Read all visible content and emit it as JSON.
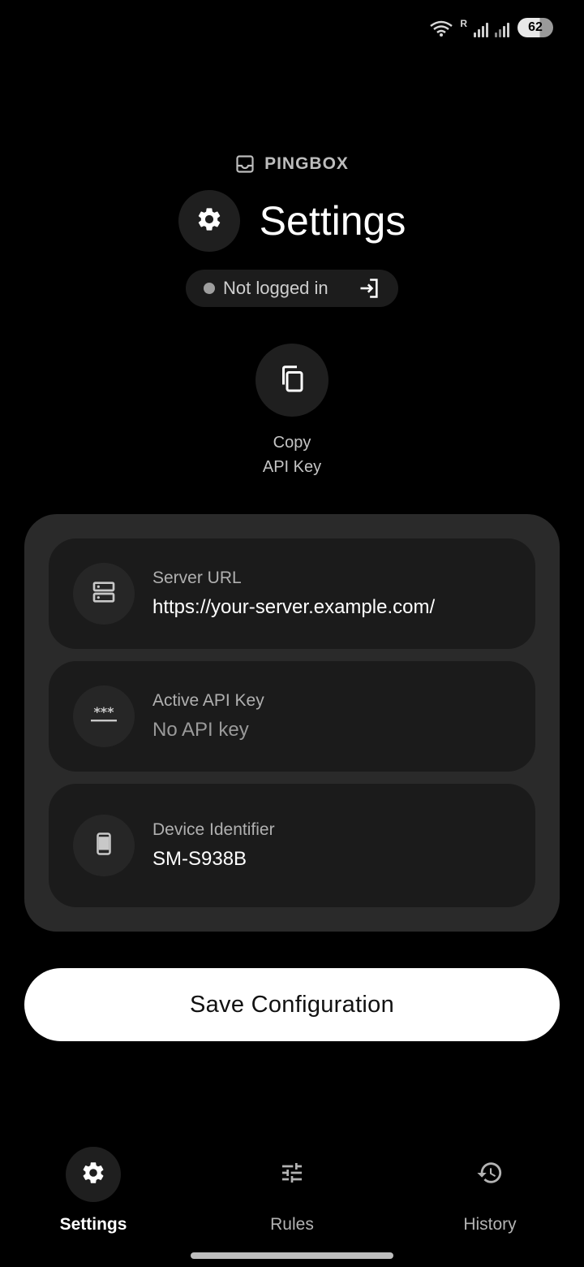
{
  "status_bar": {
    "battery_level": "62",
    "network_label": "R"
  },
  "brand": {
    "name": "PINGBOX",
    "icon": "inbox-icon"
  },
  "header": {
    "title": "Settings",
    "icon": "gear-icon"
  },
  "login": {
    "status_text": "Not logged in",
    "dot_color": "#9e9e9e",
    "icon": "login-icon"
  },
  "copy_action": {
    "icon": "copy-icon",
    "label_line1": "Copy",
    "label_line2": "API Key"
  },
  "settings": [
    {
      "label": "Server URL",
      "value": "https://your-server.example.com/",
      "icon": "server-icon",
      "muted": false
    },
    {
      "label": "Active API Key",
      "value": "No API key",
      "icon": "password-icon",
      "muted": true
    },
    {
      "label": "Device Identifier",
      "value": "SM-S938B",
      "icon": "smartphone-icon",
      "muted": false
    }
  ],
  "save_button": {
    "label": "Save Configuration"
  },
  "nav": [
    {
      "label": "Settings",
      "icon": "gear-icon",
      "active": true
    },
    {
      "label": "Rules",
      "icon": "tune-icon",
      "active": false
    },
    {
      "label": "History",
      "icon": "history-icon",
      "active": false
    }
  ],
  "colors": {
    "background": "#000000",
    "card": "#2a2a2a",
    "row": "#1b1b1b",
    "accent_button": "#ffffff"
  }
}
